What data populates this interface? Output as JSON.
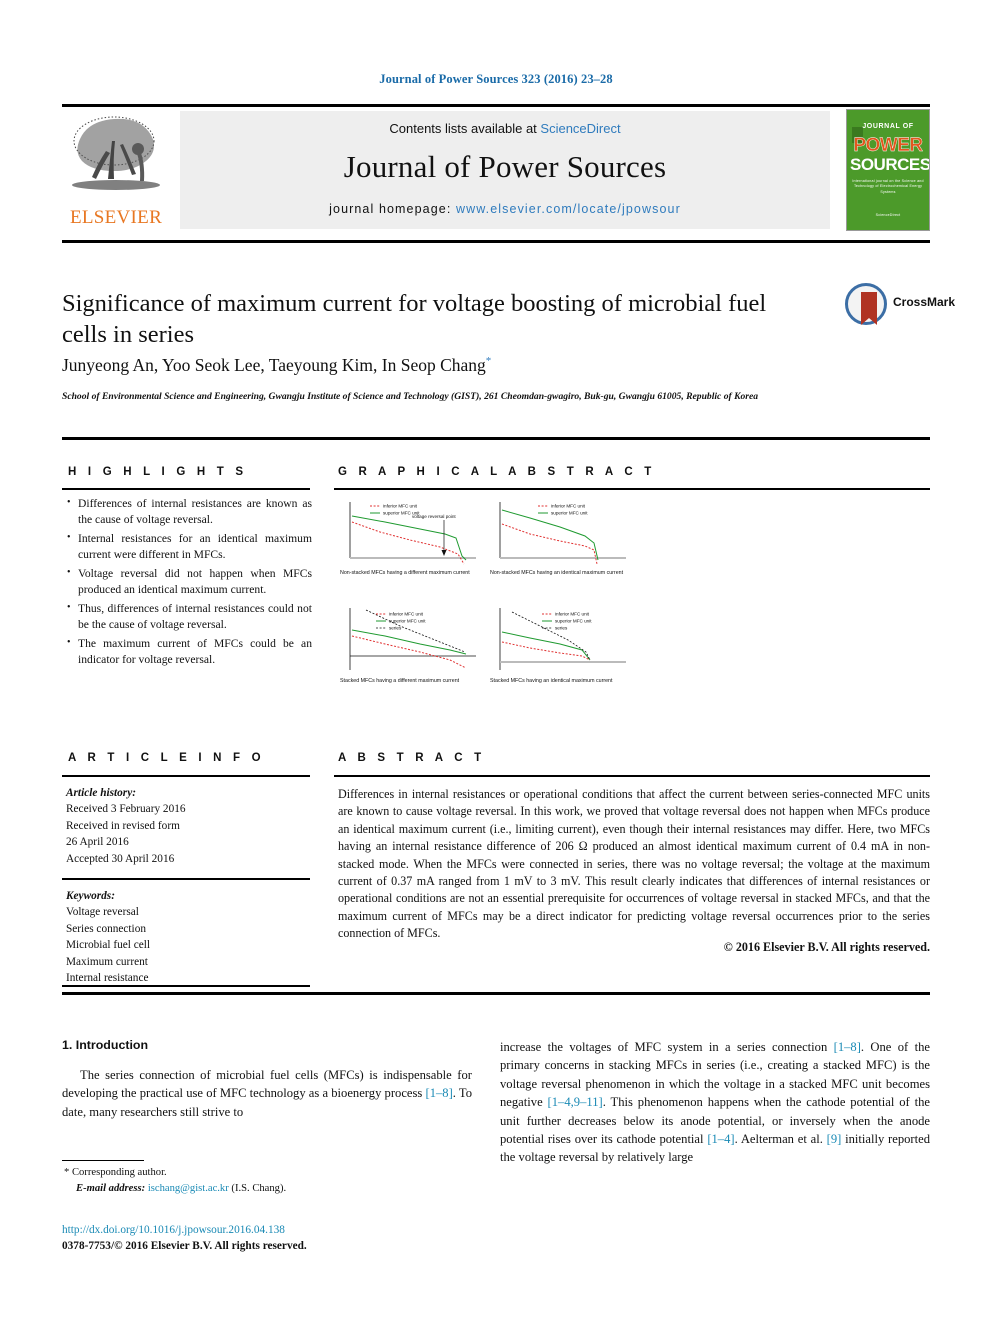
{
  "running_head": "Journal of Power Sources 323 (2016) 23–28",
  "masthead": {
    "contents_prefix": "Contents lists available at ",
    "contents_link": "ScienceDirect",
    "journal_title": "Journal of Power Sources",
    "homepage_label": "journal homepage: ",
    "homepage_url": "www.elsevier.com/locate/jpowsour",
    "publisher": "ELSEVIER",
    "cover": {
      "journal_of": "JOURNAL OF",
      "power": "POWER",
      "sources": "SOURCES",
      "subtitle": "International journal on the Science and Technology of Electrochemical Energy Systems",
      "footer": "ScienceDirect"
    }
  },
  "article": {
    "title": "Significance of maximum current for voltage boosting of microbial fuel cells in series",
    "authors": "Junyeong An, Yoo Seok Lee, Taeyoung Kim, In Seop Chang",
    "corresponding_marker": "*",
    "affiliation": "School of Environmental Science and Engineering, Gwangju Institute of Science and Technology (GIST), 261 Cheomdan-gwagiro, Buk-gu, Gwangju 61005, Republic of Korea",
    "crossmark_label": "CrossMark"
  },
  "sections": {
    "highlights_head": "H I G H L I G H T S",
    "graphical_abstract_head": "G R A P H I C A L   A B S T R A C T",
    "article_info_head": "A R T I C L E   I N F O",
    "abstract_head": "A B S T R A C T"
  },
  "highlights": [
    "Differences of internal resistances are known as the cause of voltage reversal.",
    "Internal resistances for an identical maximum current were different in MFCs.",
    "Voltage reversal did not happen when MFCs produced an identical maximum current.",
    "Thus, differences of internal resistances could not be the cause of voltage reversal.",
    "The maximum current of MFCs could be an indicator for voltage reversal."
  ],
  "graphical_abstract": {
    "panels": [
      {
        "caption": "Non-stacked MFCs having a different maximum current",
        "legend": [
          "inferior MFC unit",
          "superior MFC unit"
        ],
        "annotation": "voltage reversal point"
      },
      {
        "caption": "Non-stacked MFCs having an identical maximum current",
        "legend": [
          "inferior MFC unit",
          "superior MFC unit"
        ],
        "annotation": ""
      },
      {
        "caption": "Stacked MFCs having a different maximum current",
        "legend": [
          "inferior MFC unit",
          "superior MFC unit",
          "series"
        ],
        "annotation": ""
      },
      {
        "caption": "Stacked MFCs having an identical maximum current",
        "legend": [
          "inferior MFC unit",
          "superior MFC unit",
          "series"
        ],
        "annotation": ""
      }
    ],
    "colors": {
      "inferior": "#e03030",
      "superior": "#1f9a30",
      "series": "#111111"
    }
  },
  "article_info": {
    "history_label": "Article history:",
    "history": [
      "Received 3 February 2016",
      "Received in revised form",
      "26 April 2016",
      "Accepted 30 April 2016"
    ],
    "keywords_label": "Keywords:",
    "keywords": [
      "Voltage reversal",
      "Series connection",
      "Microbial fuel cell",
      "Maximum current",
      "Internal resistance"
    ]
  },
  "abstract": {
    "text": "Differences in internal resistances or operational conditions that affect the current between series-connected MFC units are known to cause voltage reversal. In this work, we proved that voltage reversal does not happen when MFCs produce an identical maximum current (i.e., limiting current), even though their internal resistances may differ. Here, two MFCs having an internal resistance difference of 206 Ω produced an almost identical maximum current of 0.4 mA in non-stacked mode. When the MFCs were connected in series, there was no voltage reversal; the voltage at the maximum current of 0.37 mA ranged from 1 mV to 3 mV. This result clearly indicates that differences of internal resistances or operational conditions are not an essential prerequisite for occurrences of voltage reversal in stacked MFCs, and that the maximum current of MFCs may be a direct indicator for predicting voltage reversal occurrences prior to the series connection of MFCs.",
    "copyright": "© 2016 Elsevier B.V. All rights reserved."
  },
  "body": {
    "intro_heading": "1. Introduction",
    "left_paragraph_pre": "The series connection of microbial fuel cells (MFCs) is indispensable for developing the practical use of MFC technology as a bioenergy process ",
    "left_ref_1": "[1–8]",
    "left_paragraph_post": ". To date, many researchers still strive to",
    "right_pre": "increase the voltages of MFC system in a series connection ",
    "right_ref_1": "[1–8]",
    "right_mid_1": ". One of the primary concerns in stacking MFCs in series (i.e., creating a stacked MFC) is the voltage reversal phenomenon in which the voltage in a stacked MFC unit becomes negative ",
    "right_ref_2": "[1–4,9–11]",
    "right_mid_2": ". This phenomenon happens when the cathode potential of the unit further decreases below its anode potential, or inversely when the anode potential rises over its cathode potential ",
    "right_ref_3": "[1–4]",
    "right_mid_3": ". Aelterman et al. ",
    "right_ref_4": "[9]",
    "right_end": " initially reported the voltage reversal by relatively large"
  },
  "footnote": {
    "corresponding": "* Corresponding author.",
    "email_label": "E-mail address:",
    "email": "ischang@gist.ac.kr",
    "email_owner": "(I.S. Chang)."
  },
  "footer": {
    "doi": "http://dx.doi.org/10.1016/j.jpowsour.2016.04.138",
    "issn_line": "0378-7753/© 2016 Elsevier B.V. All rights reserved."
  }
}
